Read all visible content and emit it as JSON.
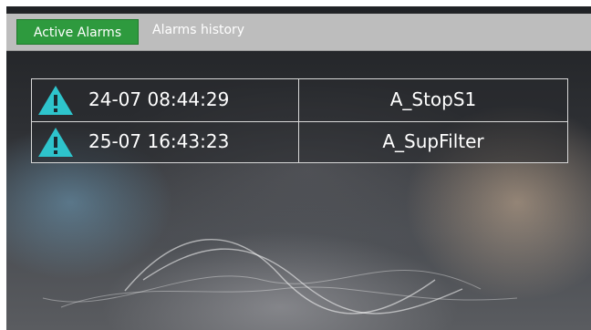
{
  "tabs": {
    "active_label": "Active Alarms",
    "history_label": "Alarms history"
  },
  "alarms": [
    {
      "icon": "warning-icon",
      "time": "24-07 08:44:29",
      "name": "A_StopS1"
    },
    {
      "icon": "warning-icon",
      "time": "25-07 16:43:23",
      "name": "A_SupFilter"
    }
  ],
  "colors": {
    "active_tab": "#2e9a3e",
    "tab_bar": "#bdbdbd",
    "warning": "#2ec4cc"
  }
}
